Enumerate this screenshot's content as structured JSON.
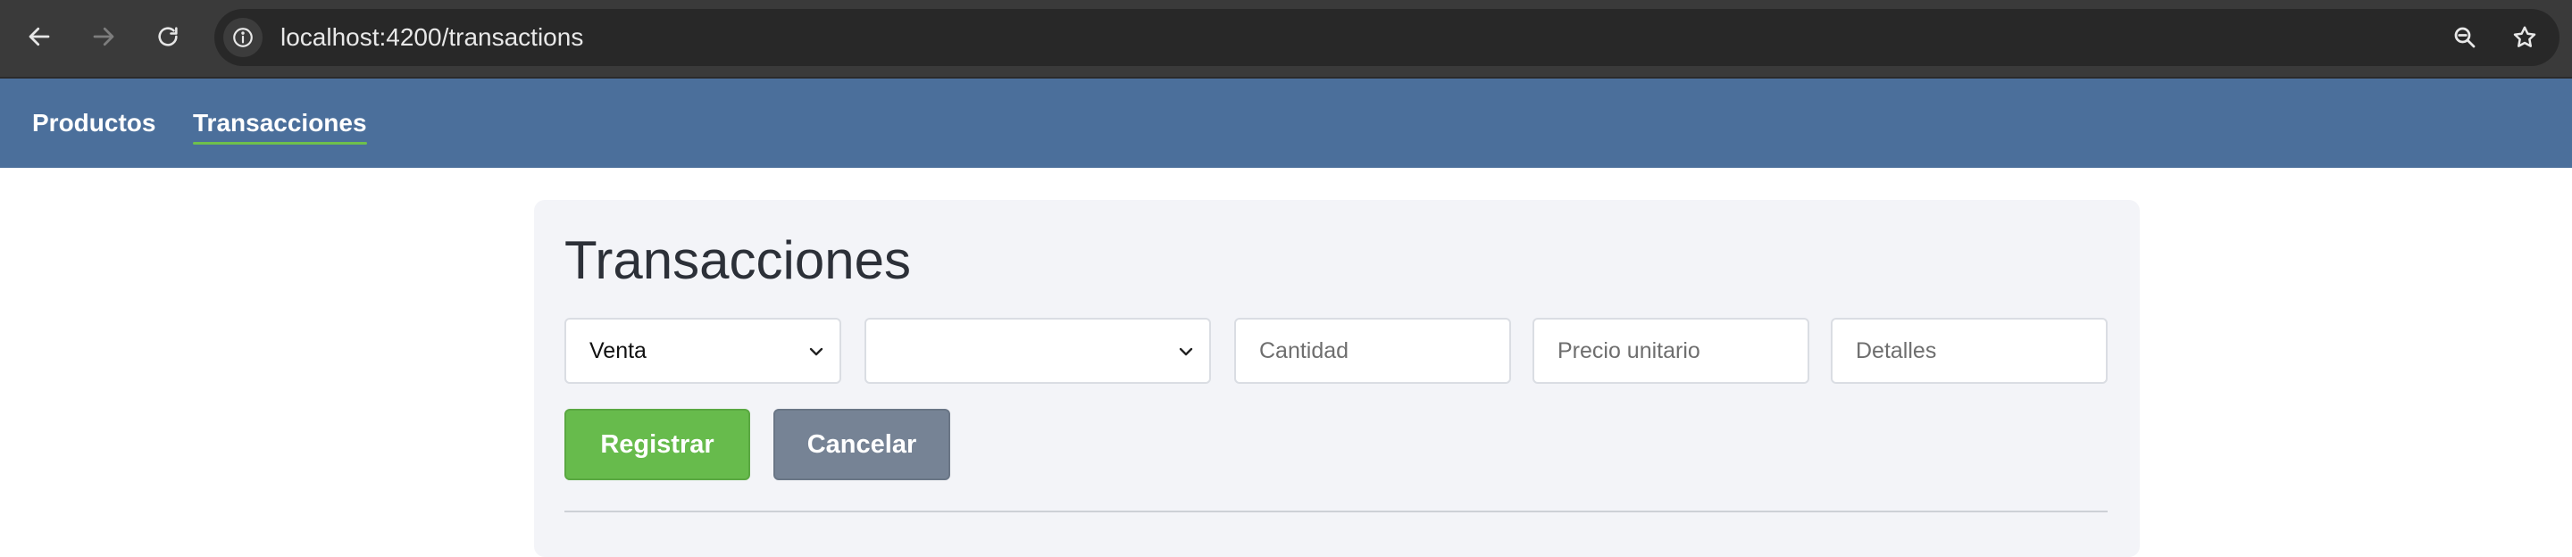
{
  "browser": {
    "url": "localhost:4200/transactions"
  },
  "navbar": {
    "links": [
      {
        "label": "Productos",
        "active": false
      },
      {
        "label": "Transacciones",
        "active": true
      }
    ]
  },
  "page": {
    "title": "Transacciones"
  },
  "form": {
    "type_select": {
      "value": "Venta"
    },
    "product_select": {
      "value": ""
    },
    "quantity": {
      "placeholder": "Cantidad",
      "value": ""
    },
    "unit_price": {
      "placeholder": "Precio unitario",
      "value": ""
    },
    "details": {
      "placeholder": "Detalles",
      "value": ""
    },
    "register_label": "Registrar",
    "cancel_label": "Cancelar"
  },
  "colors": {
    "navbar": "#4b6f9b",
    "active_underline": "#6ec04c",
    "primary_button": "#67bb4c",
    "secondary_button": "#768395"
  },
  "icons": {
    "back": "back-arrow-icon",
    "forward": "forward-arrow-icon",
    "reload": "reload-icon",
    "site_info": "info-icon",
    "zoom": "zoom-out-icon",
    "bookmark": "star-icon",
    "select": "chevron-down-icon"
  }
}
